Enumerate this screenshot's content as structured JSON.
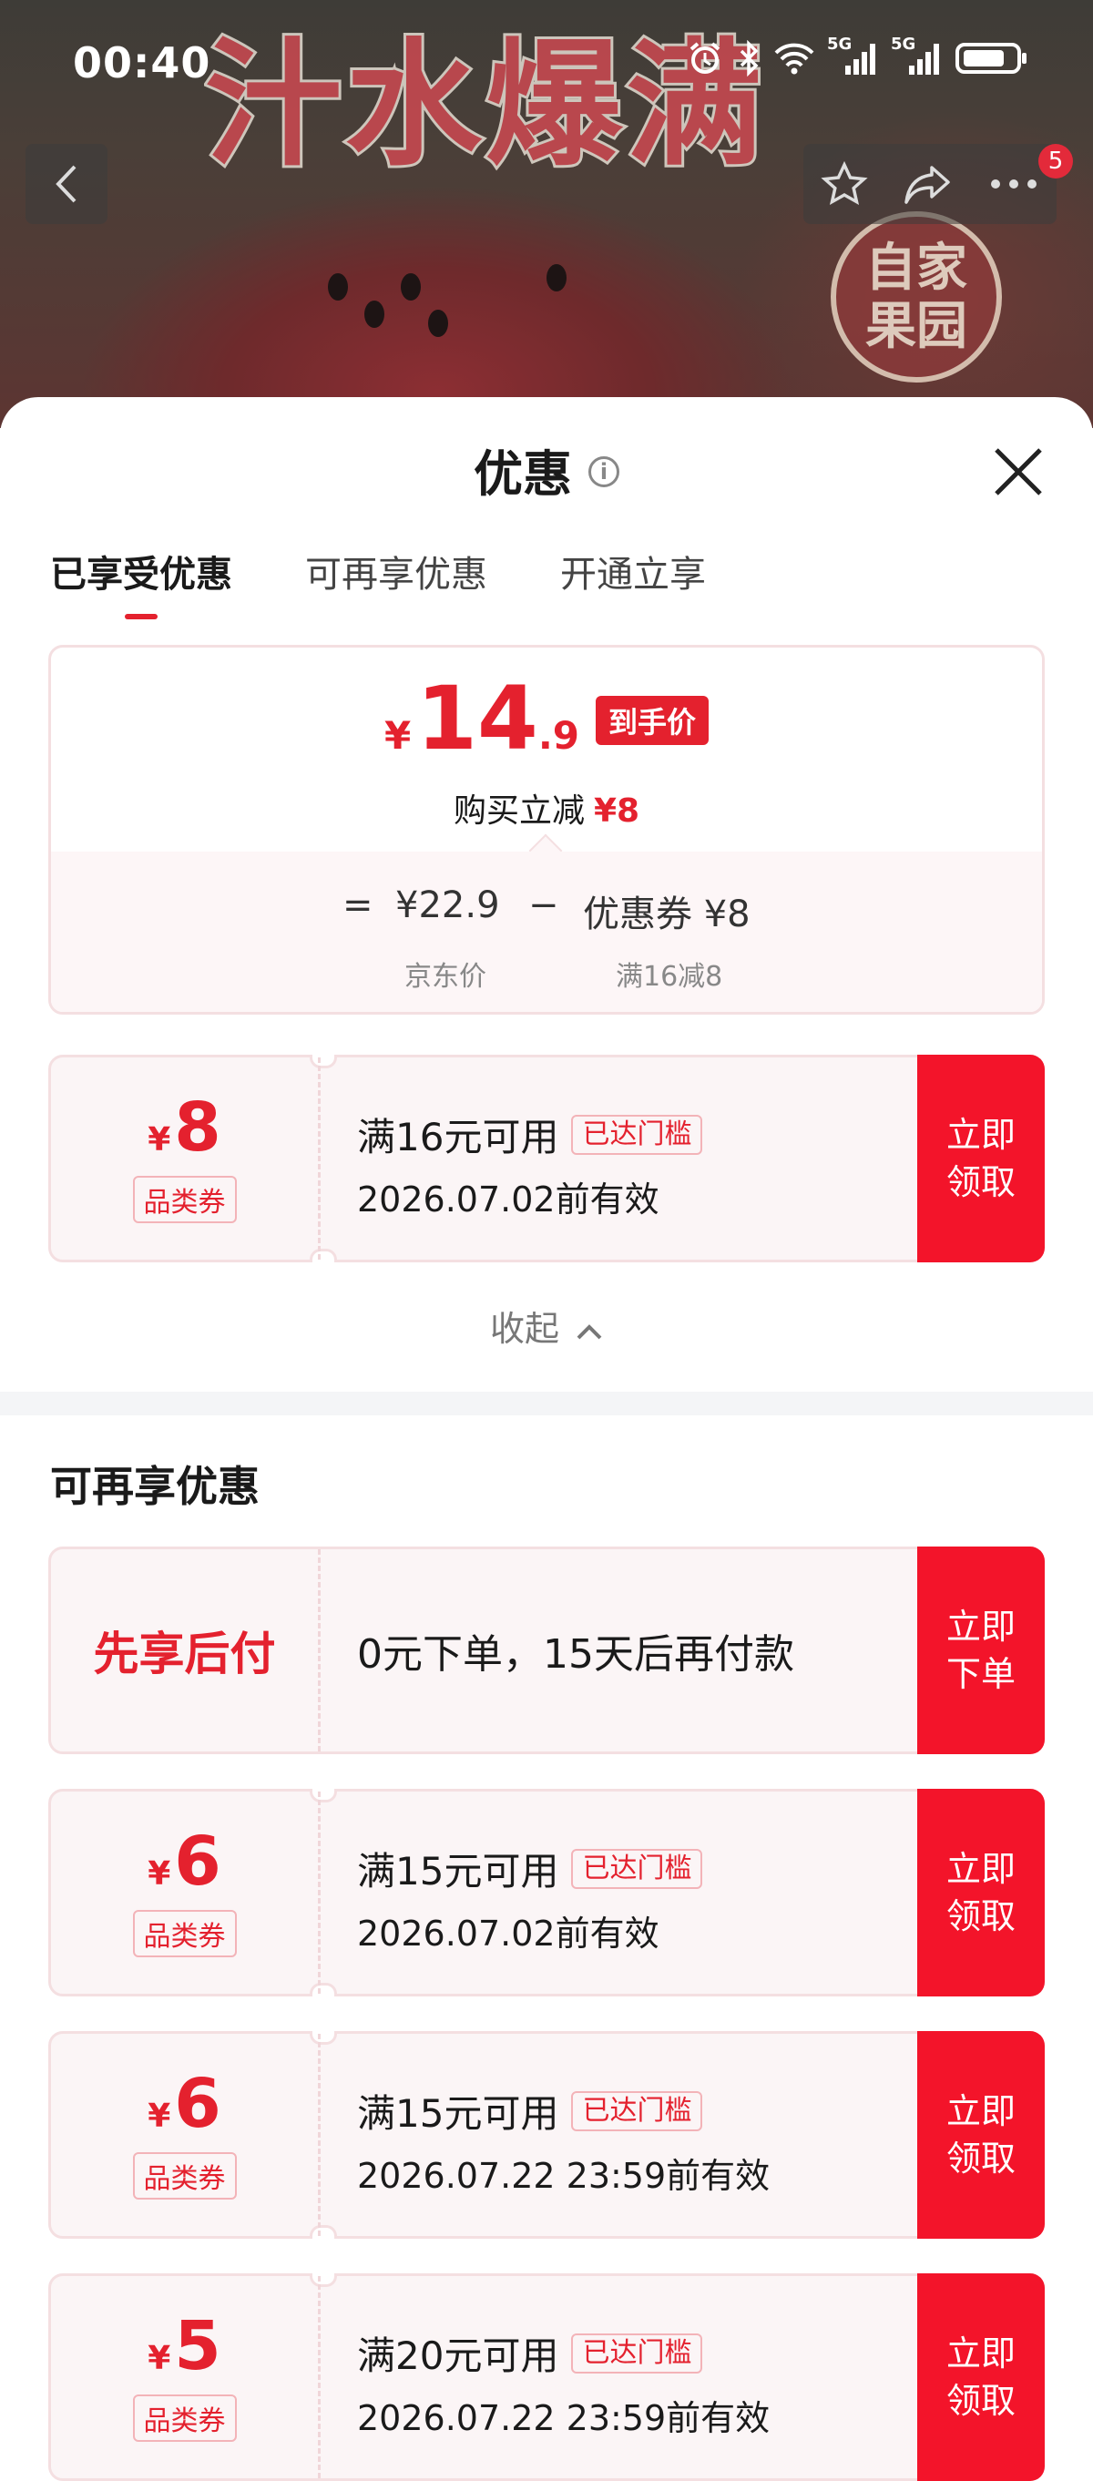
{
  "status_bar": {
    "time": "00:40",
    "network_1": "5G",
    "network_2": "5G"
  },
  "hero": {
    "title": "汁水爆满",
    "stamp_text": "自家果园"
  },
  "nav": {
    "badge_count": "5"
  },
  "sheet": {
    "title": "优惠",
    "tabs": [
      {
        "label": "已享受优惠",
        "active": true
      },
      {
        "label": "可再享优惠",
        "active": false
      },
      {
        "label": "开通立享",
        "active": false
      }
    ],
    "summary": {
      "currency": "¥",
      "price_int": "14",
      "price_dec": ".9",
      "price_tag": "到手价",
      "reduce_label": "购买立减",
      "reduce_value": "¥8",
      "eq": "=",
      "base_price": "¥22.9",
      "minus": "−",
      "coupon_label": "优惠券 ¥8",
      "base_price_label": "京东价",
      "coupon_rule": "满16减8"
    },
    "applied_coupon": {
      "currency": "¥",
      "amount": "8",
      "kind": "品类券",
      "condition": "满16元可用",
      "badge": "已达门槛",
      "validity": "2026.07.02前有效",
      "action": "立即领取"
    },
    "collapse_label": "收起",
    "more_section_title": "可再享优惠",
    "more_offers": [
      {
        "type": "pay_later",
        "title": "先享后付",
        "desc": "0元下单，15天后再付款",
        "action": "立即下单"
      },
      {
        "type": "coupon",
        "currency": "¥",
        "amount": "6",
        "kind": "品类券",
        "condition": "满15元可用",
        "badge": "已达门槛",
        "validity": "2026.07.02前有效",
        "action": "立即领取"
      },
      {
        "type": "coupon",
        "currency": "¥",
        "amount": "6",
        "kind": "品类券",
        "condition": "满15元可用",
        "badge": "已达门槛",
        "validity": "2026.07.22 23:59前有效",
        "action": "立即领取"
      },
      {
        "type": "coupon",
        "currency": "¥",
        "amount": "5",
        "kind": "品类券",
        "condition": "满20元可用",
        "badge": "已达门槛",
        "validity": "2026.07.22 23:59前有效",
        "action": "立即领取"
      }
    ]
  },
  "colors": {
    "accent": "#e4212e",
    "action_bg": "#f3142a",
    "card_border": "#f4dfe1",
    "card_bg": "#fbf5f6"
  }
}
